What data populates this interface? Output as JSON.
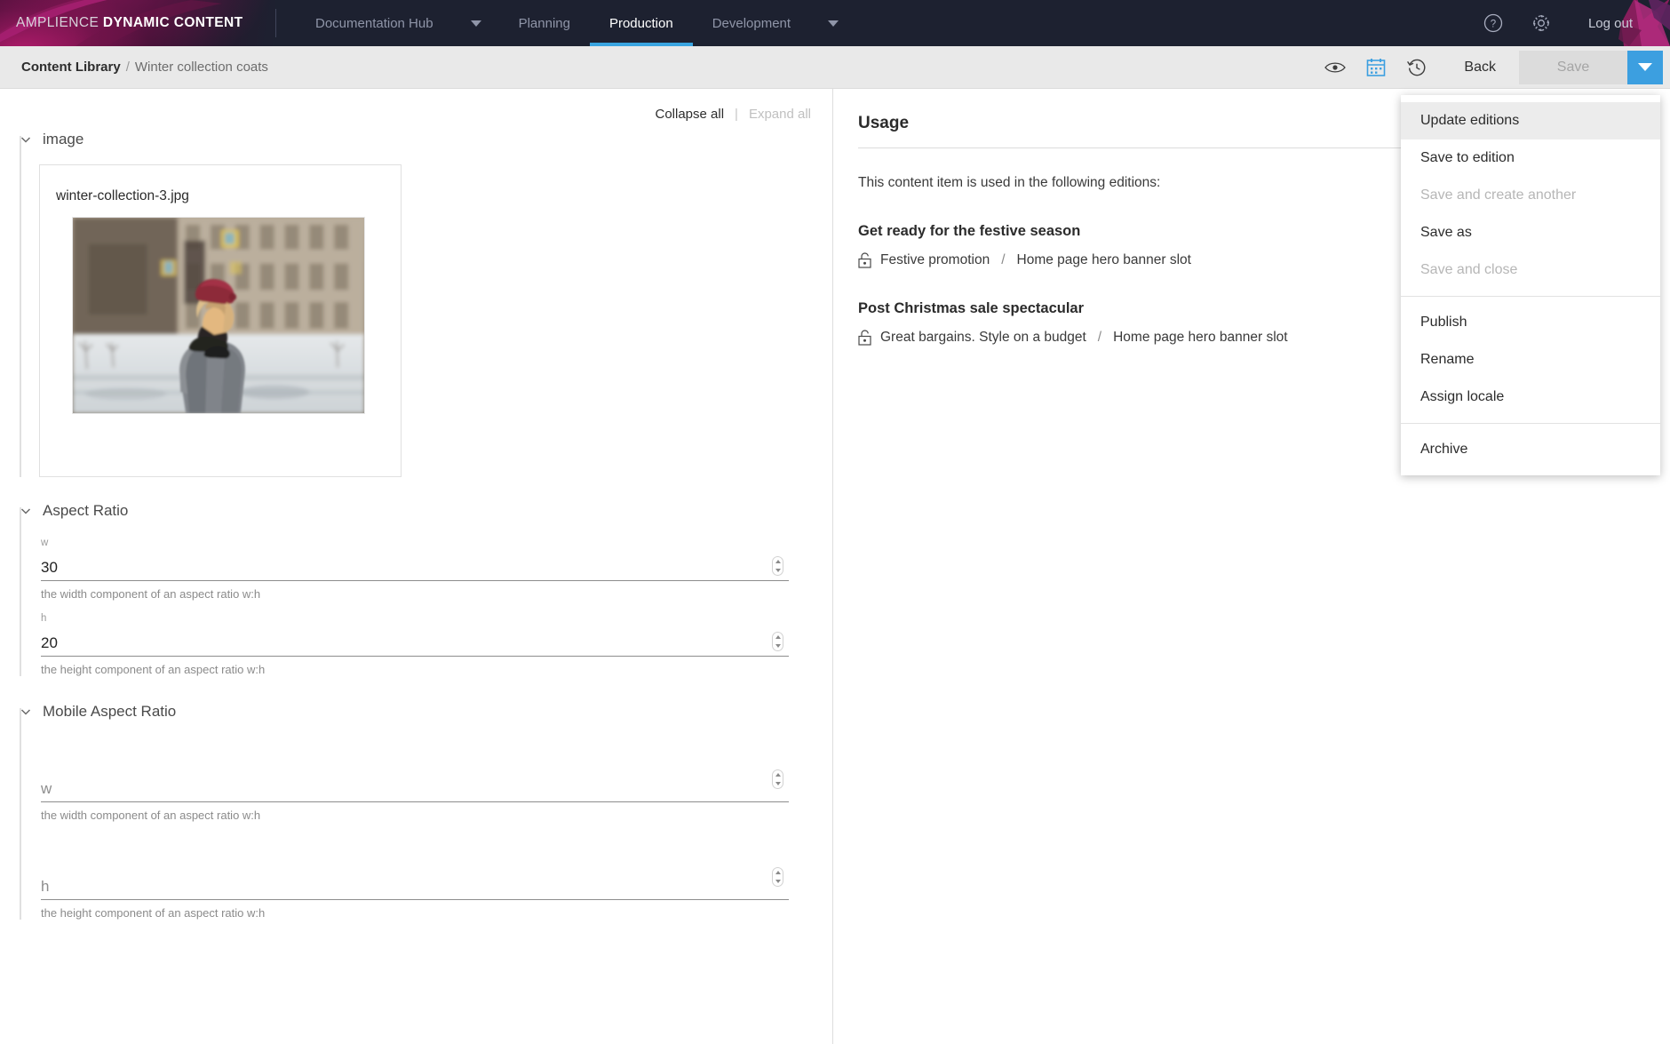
{
  "topnav": {
    "brand_light": "AMPLIENCE",
    "brand_bold": "DYNAMIC CONTENT",
    "items": [
      {
        "label": "Documentation Hub",
        "active": false,
        "has_caret": true
      },
      {
        "label": "Planning",
        "active": false,
        "has_caret": false
      },
      {
        "label": "Production",
        "active": true,
        "has_caret": false
      },
      {
        "label": "Development",
        "active": false,
        "has_caret": true
      }
    ],
    "help_icon": "help-circle-icon",
    "settings_icon": "gear-icon",
    "logout_label": "Log out",
    "accent_color": "#39a4e0",
    "background_color": "#1d2130"
  },
  "subbar": {
    "breadcrumb_root": "Content Library",
    "breadcrumb_separator": "/",
    "breadcrumb_current": "Winter collection coats",
    "preview_icon": "eye-icon",
    "schedule_icon": "calendar-icon",
    "history_icon": "history-clock-icon",
    "back_label": "Back",
    "save_label": "Save",
    "save_disabled": true,
    "save_caret_icon": "chevron-down-icon",
    "save_caret_color": "#3c9fe0"
  },
  "dropdown": {
    "items": [
      {
        "label": "Update editions",
        "disabled": false,
        "hovered": true
      },
      {
        "label": "Save to edition",
        "disabled": false,
        "hovered": false
      },
      {
        "label": "Save and create another",
        "disabled": true,
        "hovered": false
      },
      {
        "label": "Save as",
        "disabled": false,
        "hovered": false
      },
      {
        "label": "Save and close",
        "disabled": true,
        "hovered": false
      }
    ],
    "items2": [
      {
        "label": "Publish",
        "disabled": false
      },
      {
        "label": "Rename",
        "disabled": false
      },
      {
        "label": "Assign locale",
        "disabled": false
      }
    ],
    "items3": [
      {
        "label": "Archive",
        "disabled": false
      }
    ]
  },
  "form": {
    "collapse_all": "Collapse all",
    "collapse_separator": "|",
    "expand_all": "Expand all",
    "image_section": {
      "title": "image",
      "filename": "winter-collection-3.jpg",
      "thumbnail_alt": "Woman in red beret and grey coat on snowy city street"
    },
    "aspect_ratio": {
      "title": "Aspect Ratio",
      "w": {
        "label": "w",
        "value": "30",
        "placeholder": "",
        "help": "the width component of an aspect ratio w:h"
      },
      "h": {
        "label": "h",
        "value": "20",
        "placeholder": "",
        "help": "the height component of an aspect ratio w:h"
      }
    },
    "mobile_aspect_ratio": {
      "title": "Mobile Aspect Ratio",
      "w": {
        "label": "",
        "value": "",
        "placeholder": "w",
        "help": "the width component of an aspect ratio w:h"
      },
      "h": {
        "label": "",
        "value": "",
        "placeholder": "h",
        "help": "the height component of an aspect ratio w:h"
      }
    }
  },
  "usage": {
    "title": "Usage",
    "intro": "This content item is used in the following editions:",
    "editions": [
      {
        "name": "Get ready for the festive season",
        "lock_icon": "unlocked-padlock-icon",
        "slot_edition": "Festive promotion",
        "slot_separator": "/",
        "slot_name": "Home page hero banner slot"
      },
      {
        "name": "Post Christmas sale spectacular",
        "lock_icon": "unlocked-padlock-icon",
        "slot_edition": "Great bargains. Style on a budget",
        "slot_separator": "/",
        "slot_name": "Home page hero banner slot"
      }
    ]
  }
}
